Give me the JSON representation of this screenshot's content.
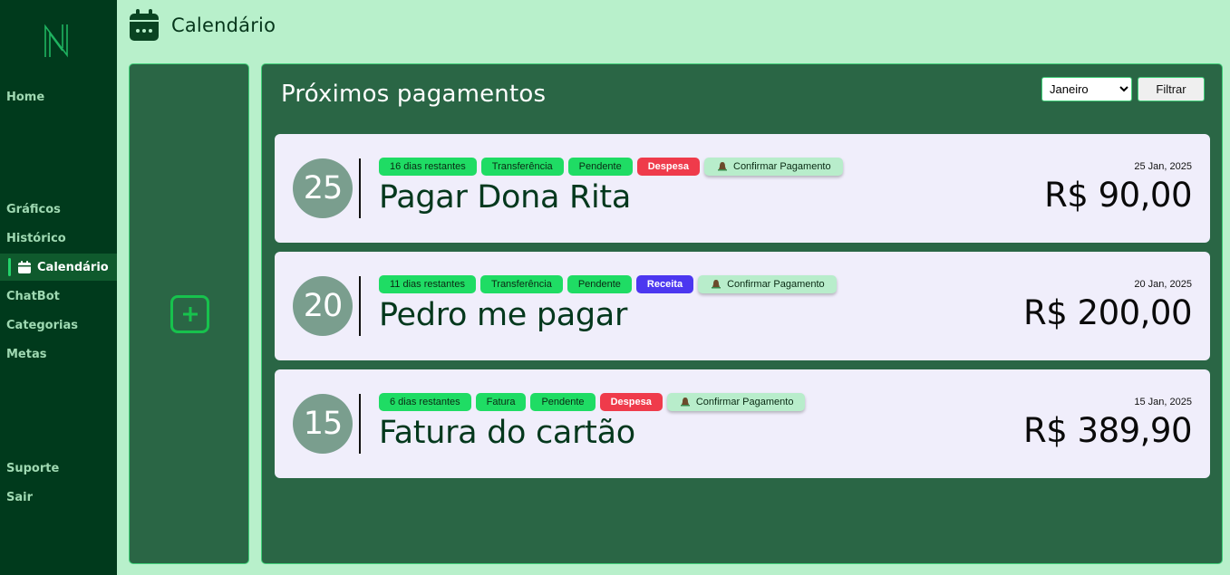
{
  "app": {
    "logo_icon": "n-logo-icon"
  },
  "sidebar": {
    "items": [
      {
        "label": "Home"
      },
      {
        "label": "Gráficos"
      },
      {
        "label": "Histórico"
      },
      {
        "label": "Calendário",
        "icon": "calendar-icon",
        "active": true
      },
      {
        "label": "ChatBot"
      },
      {
        "label": "Categorias"
      },
      {
        "label": "Metas"
      },
      {
        "label": "Suporte"
      },
      {
        "label": "Sair"
      }
    ]
  },
  "header": {
    "title": "Calendário",
    "icon": "calendar-icon"
  },
  "add_panel": {
    "icon": "plus-icon"
  },
  "main": {
    "title": "Próximos pagamentos",
    "month_filter": {
      "selected": "Janeiro"
    },
    "filter_button": "Filtrar",
    "payments": [
      {
        "day": "25",
        "tags": [
          {
            "text": "16 dias restantes",
            "kind": "green"
          },
          {
            "text": "Transferência",
            "kind": "green"
          },
          {
            "text": "Pendente",
            "kind": "green"
          },
          {
            "text": "Despesa",
            "kind": "red"
          }
        ],
        "confirm_label": "Confirmar Pagamento",
        "title": "Pagar Dona Rita",
        "date": "25 Jan, 2025",
        "amount": "R$ 90,00"
      },
      {
        "day": "20",
        "tags": [
          {
            "text": "11 dias restantes",
            "kind": "green"
          },
          {
            "text": "Transferência",
            "kind": "green"
          },
          {
            "text": "Pendente",
            "kind": "green"
          },
          {
            "text": "Receita",
            "kind": "blue"
          }
        ],
        "confirm_label": "Confirmar Pagamento",
        "title": "Pedro me pagar",
        "date": "20 Jan, 2025",
        "amount": "R$ 200,00"
      },
      {
        "day": "15",
        "tags": [
          {
            "text": "6 dias restantes",
            "kind": "green"
          },
          {
            "text": "Fatura",
            "kind": "green"
          },
          {
            "text": "Pendente",
            "kind": "green"
          },
          {
            "text": "Despesa",
            "kind": "red"
          }
        ],
        "confirm_label": "Confirmar Pagamento",
        "title": "Fatura do cartão",
        "date": "15 Jan, 2025",
        "amount": "R$ 389,90"
      }
    ]
  },
  "colors": {
    "background": "#b8f0cb",
    "sidebar": "#003a1c",
    "panel": "#2a6645",
    "tag_green": "#1fdc64",
    "tag_red": "#ef3b4b",
    "tag_blue": "#4c37f0",
    "card": "#f0eefb"
  }
}
